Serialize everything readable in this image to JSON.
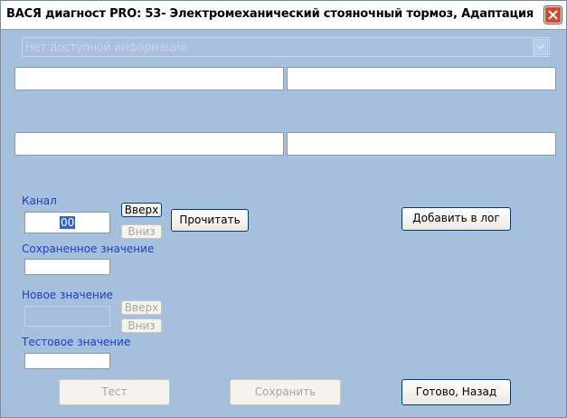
{
  "window": {
    "title": "ВАСЯ диагност PRO: 53- Электромеханический стояночный тормоз, Адаптация",
    "close_icon": "close-icon"
  },
  "info_combo": {
    "value": "Нет доступной информации",
    "arrow_icon": "chevron-down-icon"
  },
  "channel": {
    "label": "Канал",
    "value": "00",
    "up_label": "Вверх",
    "down_label": "Вниз",
    "read_label": "Прочитать"
  },
  "saved_value": {
    "label": "Сохраненное значение",
    "value": ""
  },
  "new_value": {
    "label": "Новое значение",
    "value": "",
    "up_label": "Вверх",
    "down_label": "Вниз"
  },
  "test_value": {
    "label": "Тестовое значение",
    "value": ""
  },
  "buttons": {
    "add_to_log": "Добавить в лог",
    "test": "Тест",
    "save": "Сохранить",
    "done_back": "Готово, Назад"
  },
  "colors": {
    "background": "#a6bfdc",
    "label": "#1a3ecf",
    "close": "#d2472e"
  }
}
